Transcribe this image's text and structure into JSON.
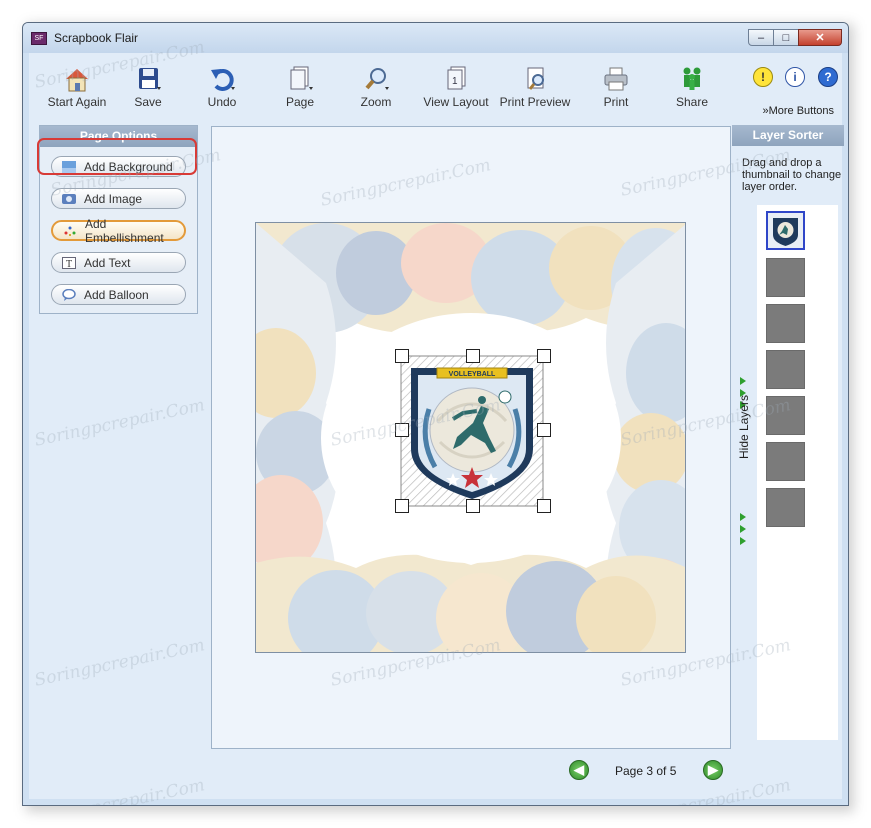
{
  "window": {
    "title": "Scrapbook Flair",
    "minimize": "–",
    "maximize": "□",
    "close": "✕"
  },
  "toolbar": {
    "buttons": [
      {
        "label": "Start Again",
        "icon": "house-icon"
      },
      {
        "label": "Save",
        "icon": "floppy-icon"
      },
      {
        "label": "Undo",
        "icon": "undo-icon"
      },
      {
        "label": "Page",
        "icon": "page-icon"
      },
      {
        "label": "Zoom",
        "icon": "magnifier-icon"
      },
      {
        "label": "View Layout",
        "icon": "view-layout-icon"
      },
      {
        "label": "Print Preview",
        "icon": "print-preview-icon"
      },
      {
        "label": "Print",
        "icon": "printer-icon"
      },
      {
        "label": "Share",
        "icon": "people-icon"
      }
    ],
    "help_icons": [
      "!",
      "i",
      "?"
    ],
    "more_buttons": "More Buttons"
  },
  "page_options": {
    "title": "Page Options",
    "buttons": [
      {
        "label": "Add Background"
      },
      {
        "label": "Add Image"
      },
      {
        "label": "Add Embellishment"
      },
      {
        "label": "Add Text"
      },
      {
        "label": "Add Balloon"
      }
    ]
  },
  "layer_sorter": {
    "title": "Layer Sorter",
    "instructions": "Drag and drop a thumbnail to change layer order.",
    "hide_layers": "Hide Layers"
  },
  "embellishment": {
    "banner": "VOLLEYBALL"
  },
  "pager": {
    "text": "Page 3 of 5",
    "prev": "◀",
    "next": "▶"
  },
  "watermark": "Soringpcrepair.Com",
  "colors": {
    "accent_orange": "#e39a3a",
    "highlight_red": "#d83a36",
    "nav_green": "#2e8a28",
    "shield_navy": "#1f3a5c"
  }
}
